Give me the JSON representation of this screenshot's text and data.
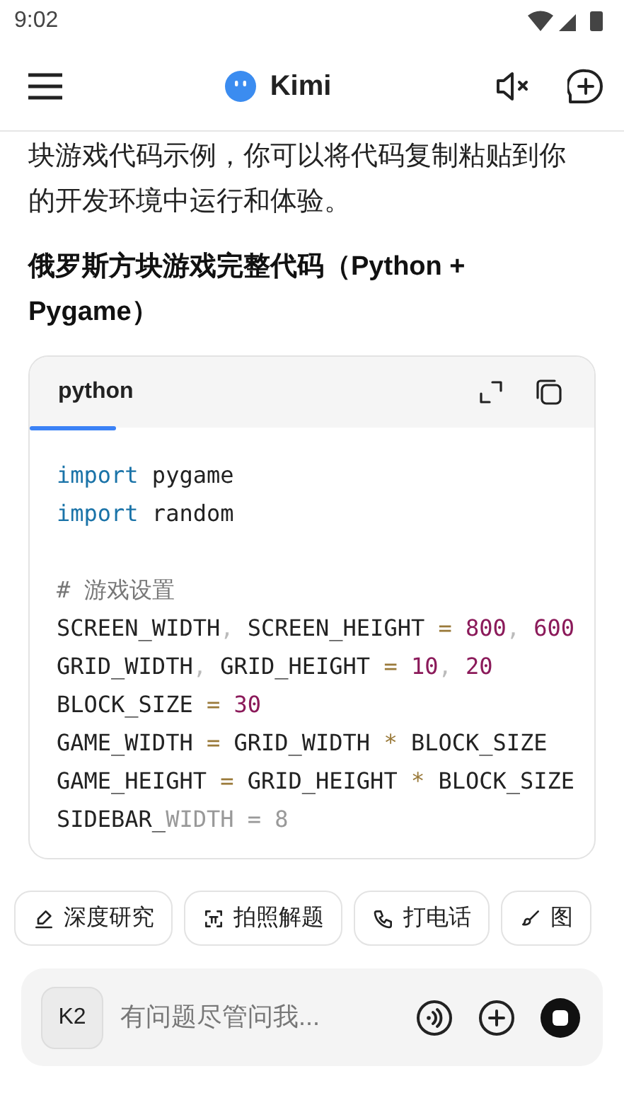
{
  "status_bar": {
    "time": "9:02"
  },
  "header": {
    "title": "Kimi"
  },
  "message": {
    "paragraph": "块游戏代码示例，你可以将代码复制粘贴到你的开发环境中运行和体验。",
    "heading": "俄罗斯方块游戏完整代码（Python + Pygame）"
  },
  "code_block": {
    "language": "python",
    "lines": [
      [
        {
          "kind": "keyword",
          "text": "import"
        },
        {
          "kind": "plain",
          "text": " pygame"
        }
      ],
      [
        {
          "kind": "keyword",
          "text": "import"
        },
        {
          "kind": "plain",
          "text": " random"
        }
      ],
      [
        {
          "kind": "blank"
        }
      ],
      [
        {
          "kind": "comment",
          "text": "# 游戏设置"
        }
      ],
      [
        {
          "kind": "plain",
          "text": "SCREEN_WIDTH"
        },
        {
          "kind": "punct",
          "text": ", "
        },
        {
          "kind": "plain",
          "text": "SCREEN_HEIGHT "
        },
        {
          "kind": "operator",
          "text": "= "
        },
        {
          "kind": "number",
          "text": "800"
        },
        {
          "kind": "punct",
          "text": ", "
        },
        {
          "kind": "number",
          "text": "600"
        }
      ],
      [
        {
          "kind": "plain",
          "text": "GRID_WIDTH"
        },
        {
          "kind": "punct",
          "text": ", "
        },
        {
          "kind": "plain",
          "text": "GRID_HEIGHT "
        },
        {
          "kind": "operator",
          "text": "= "
        },
        {
          "kind": "number",
          "text": "10"
        },
        {
          "kind": "punct",
          "text": ", "
        },
        {
          "kind": "number",
          "text": "20"
        }
      ],
      [
        {
          "kind": "plain",
          "text": "BLOCK_SIZE "
        },
        {
          "kind": "operator",
          "text": "= "
        },
        {
          "kind": "number",
          "text": "30"
        }
      ],
      [
        {
          "kind": "plain",
          "text": "GAME_WIDTH "
        },
        {
          "kind": "operator",
          "text": "= "
        },
        {
          "kind": "plain",
          "text": "GRID_WIDTH "
        },
        {
          "kind": "operator",
          "text": "* "
        },
        {
          "kind": "plain",
          "text": "BLOCK_SIZE"
        }
      ],
      [
        {
          "kind": "plain",
          "text": "GAME_HEIGHT "
        },
        {
          "kind": "operator",
          "text": "= "
        },
        {
          "kind": "plain",
          "text": "GRID_HEIGHT "
        },
        {
          "kind": "operator",
          "text": "* "
        },
        {
          "kind": "plain",
          "text": "BLOCK_SIZE"
        }
      ],
      [
        {
          "kind": "plain",
          "text": "SIDEBAR_"
        },
        {
          "kind": "faded",
          "text": "WIDTH = 8"
        }
      ]
    ]
  },
  "chips": [
    {
      "label": "深度研究"
    },
    {
      "label": "拍照解题"
    },
    {
      "label": "打电话"
    },
    {
      "label": "图"
    }
  ],
  "composer": {
    "model": "K2",
    "placeholder": "有问题尽管问我..."
  }
}
